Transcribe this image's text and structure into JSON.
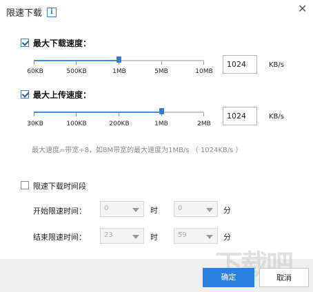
{
  "dialog": {
    "title": "限速下载",
    "info_icon": "i"
  },
  "download": {
    "label": "最大下载速度：",
    "checked": true,
    "ticks": [
      "60KB",
      "500KB",
      "1MB",
      "5MB",
      "10MB"
    ],
    "value": "1024",
    "unit": "KB/s"
  },
  "upload": {
    "label": "最大上传速度：",
    "checked": true,
    "ticks": [
      "30KB",
      "100KB",
      "200KB",
      "1MB",
      "2MB"
    ],
    "value": "1024",
    "unit": "KB/s"
  },
  "note": "最大速度=带宽÷8，如8M带宽的最大速度为1MB/s （ 1024KB/s ）",
  "schedule": {
    "label": "限速下载时间段",
    "checked": false,
    "start_label": "开始限速时间：",
    "end_label": "结束限速时间：",
    "start_hour": "0",
    "start_minute": "0",
    "end_hour": "23",
    "end_minute": "59",
    "hour_unit": "时",
    "minute_unit": "分"
  },
  "buttons": {
    "ok": "确定",
    "cancel": "取消"
  },
  "watermark": "下载吧",
  "colors": {
    "accent": "#2b7fe0",
    "checkbox": "#1f5aa6"
  }
}
